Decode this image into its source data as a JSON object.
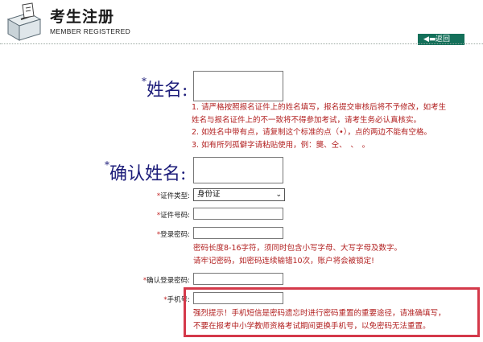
{
  "header": {
    "title_cn": "考生注册",
    "title_en": "MEMBER REGISTERED",
    "back_label": "返回",
    "back_icon": "arrow-left-icon",
    "logo_icon": "ballot-box-icon",
    "accent_color": "#14705a"
  },
  "form": {
    "name": {
      "star": "*",
      "label": "姓名:"
    },
    "name_notes": [
      "1. 请严格按照报名证件上的姓名填写，报名提交审核后将不予修改，如考生",
      "姓名与报名证件上的不一致将不得参加考试，请考生务必认真核实。",
      "2. 如姓名中带有点，请复制这个标准的点（•），点的两边不能有空格。",
      "3. 如有所列孤僻字请粘贴使用，例：龑、仝、　、　。"
    ],
    "confirm_name": {
      "star": "*",
      "label": "确认姓名:"
    },
    "id_type": {
      "star": "*",
      "label": "证件类型:",
      "value": "身份证"
    },
    "id_number": {
      "star": "*",
      "label": "证件号码:"
    },
    "password": {
      "star": "*",
      "label": "登录密码:"
    },
    "password_notes": [
      "密码长度8-16字符，须同时包含小写字母、大写字母及数字。",
      "请牢记密码，如密码连续输错10次，账户将会被锁定!"
    ],
    "confirm_password": {
      "star": "*",
      "label": "确认登录密码:"
    },
    "phone": {
      "star": "*",
      "label": "手机号:"
    },
    "phone_notes": [
      "强烈提示！手机短信是密码遗忘时进行密码重置的重要途径，请准确填写，",
      "不要在报考中小学教师资格考试期间更换手机号，以免密码无法重置。"
    ]
  },
  "colors": {
    "note_red": "#b22020",
    "label_navy": "#1d1d7a",
    "highlight_box": "#d4394a"
  }
}
